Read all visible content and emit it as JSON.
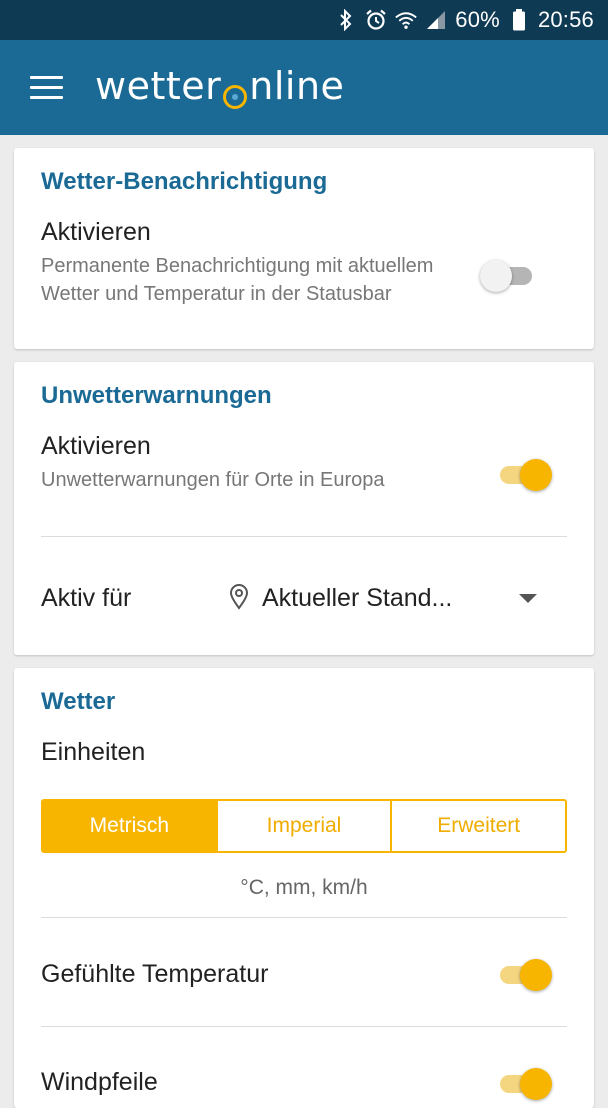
{
  "status_bar": {
    "battery": "60%",
    "time": "20:56",
    "icons": [
      "bluetooth-icon",
      "alarm-icon",
      "wifi-icon",
      "signal-icon",
      "battery-icon"
    ]
  },
  "app_bar": {
    "logo_left": "wetter",
    "logo_right": "nline",
    "menu_icon": "hamburger-menu-icon"
  },
  "colors": {
    "app_bar": "#1a6a95",
    "status_bar": "#0e3a54",
    "accent": "#f7b500",
    "title": "#1a6a95"
  },
  "notification": {
    "title": "Wetter-Benachrichtigung",
    "item_title": "Aktivieren",
    "item_sub": "Permanente Benachrichtigung mit aktuellem Wetter und Temperatur in der Statusbar",
    "enabled": false
  },
  "warnings": {
    "title": "Unwetterwarnungen",
    "item_title": "Aktivieren",
    "item_sub": "Unwetterwarnungen für Orte in Europa",
    "enabled": true,
    "active_for_label": "Aktiv für",
    "location_value": "Aktueller Stand..."
  },
  "weather": {
    "title": "Wetter",
    "units_label": "Einheiten",
    "unit_options": [
      "Metrisch",
      "Imperial",
      "Erweitert"
    ],
    "selected_unit": "Metrisch",
    "units_hint": "°C, mm, km/h",
    "felt_temp_label": "Gefühlte Temperatur",
    "felt_temp_enabled": true,
    "wind_label": "Windpfeile",
    "wind_enabled": true
  }
}
